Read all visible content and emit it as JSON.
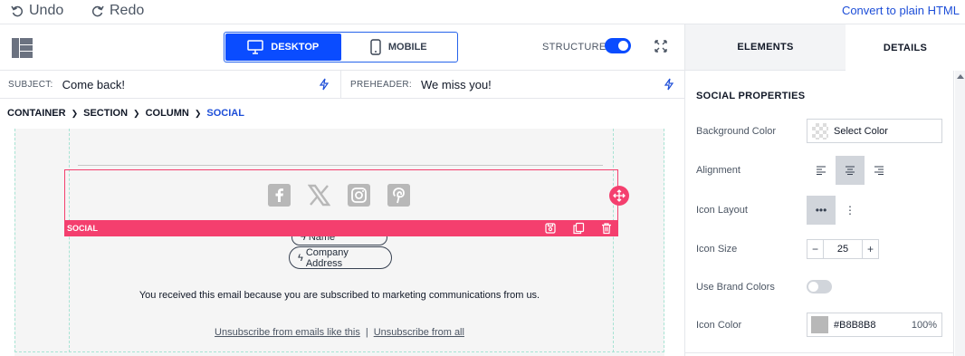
{
  "toolbar": {
    "undo": "Undo",
    "redo": "Redo",
    "convert": "Convert to plain HTML"
  },
  "view": {
    "desktop": "DESKTOP",
    "mobile": "MOBILE",
    "structure": "STRUCTURE",
    "structure_on": true
  },
  "subject": {
    "label": "SUBJECT:",
    "value": "Come back!"
  },
  "preheader": {
    "label": "PREHEADER:",
    "value": "We miss you!"
  },
  "breadcrumb": [
    "CONTAINER",
    "SECTION",
    "COLUMN",
    "SOCIAL"
  ],
  "canvas": {
    "social_label": "SOCIAL",
    "social_icons": [
      "facebook-icon",
      "x-icon",
      "instagram-icon",
      "pinterest-icon"
    ],
    "company_name": "Company Name",
    "company_address": "Company Address",
    "notice": "You received this email because you are subscribed to marketing communications from us.",
    "unsub_like": "Unsubscribe from emails like this",
    "unsub_sep": "|",
    "unsub_all": "Unsubscribe from all"
  },
  "panel": {
    "tabs": [
      "ELEMENTS",
      "DETAILS"
    ],
    "title": "SOCIAL PROPERTIES",
    "bg_label": "Background Color",
    "bg_value": "Select Color",
    "alignment_label": "Alignment",
    "alignment_selected": "center",
    "icon_layout_label": "Icon Layout",
    "icon_layout_selected": "horizontal",
    "icon_size_label": "Icon Size",
    "icon_size_value": "25",
    "brand_colors_label": "Use Brand Colors",
    "brand_colors_on": false,
    "icon_color_label": "Icon Color",
    "icon_color_hex": "#B8B8B8",
    "icon_color_opacity": "100%"
  },
  "colors": {
    "accent": "#0a4cff",
    "social": "#f43f6e",
    "icon": "#b8b8b8"
  }
}
